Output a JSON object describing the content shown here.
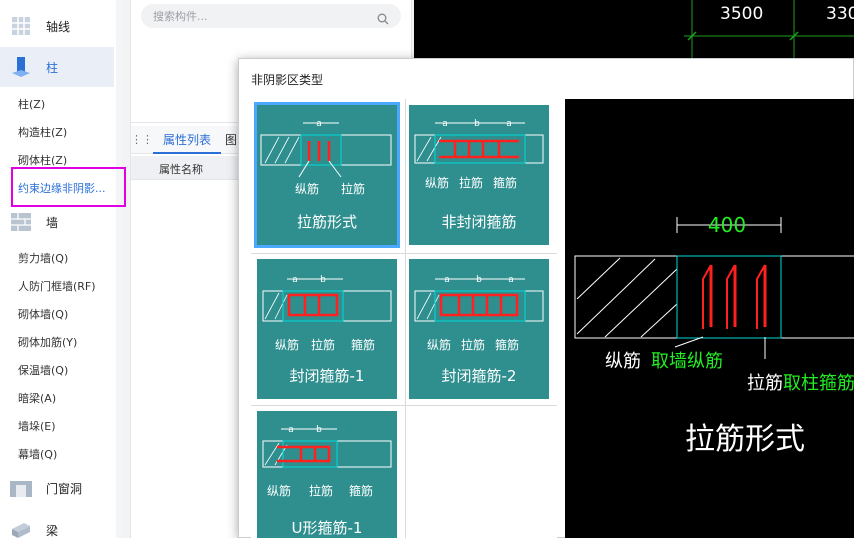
{
  "sidebar": {
    "categories": {
      "axis": "轴线",
      "column": "柱",
      "wall": "墙",
      "door_window": "门窗洞",
      "beam": "梁"
    },
    "column_items": [
      "柱(Z)",
      "构造柱(Z)",
      "砌体柱(Z)",
      "约束边缘非阴影..."
    ],
    "wall_items": [
      "剪力墙(Q)",
      "人防门框墙(RF)",
      "砌体墙(Q)",
      "砌体加筋(Y)",
      "保温墙(Q)",
      "暗梁(A)",
      "墙垛(E)",
      "幕墙(Q)"
    ]
  },
  "search": {
    "placeholder": "搜索构件..."
  },
  "props": {
    "tab_active": "属性列表",
    "tab_second": "图",
    "col_name": "属性名称"
  },
  "canvas_top": {
    "dims": [
      "3500",
      "330"
    ]
  },
  "dialog": {
    "title": "非阴影区类型",
    "tiles": [
      {
        "caption": "拉筋形式",
        "labels": [
          "a",
          "纵筋",
          "拉筋"
        ]
      },
      {
        "caption": "非封闭箍筋",
        "labels": [
          "a",
          "b",
          "a",
          "纵筋",
          "拉筋",
          "箍筋"
        ]
      },
      {
        "caption": "封闭箍筋-1",
        "labels": [
          "a",
          "b",
          "纵筋",
          "拉筋",
          "箍筋"
        ]
      },
      {
        "caption": "封闭箍筋-2",
        "labels": [
          "a",
          "b",
          "a",
          "纵筋",
          "拉筋",
          "箍筋"
        ]
      },
      {
        "caption": "U形箍筋-1",
        "labels": [
          "a",
          "b",
          "纵筋",
          "拉筋",
          "箍筋"
        ]
      }
    ],
    "preview": {
      "dim": "400",
      "label1_white": "纵筋",
      "label1_green": "取墙纵筋",
      "label2_white": "拉筋",
      "label2_green": "取柱箍筋",
      "caption": "拉筋形式"
    }
  },
  "colors": {
    "accent": "#2a6fd6",
    "tile": "#2f8f8f",
    "highlight": "#e100e1",
    "rebar": "#ff2020",
    "dim_green": "#22ee22"
  }
}
